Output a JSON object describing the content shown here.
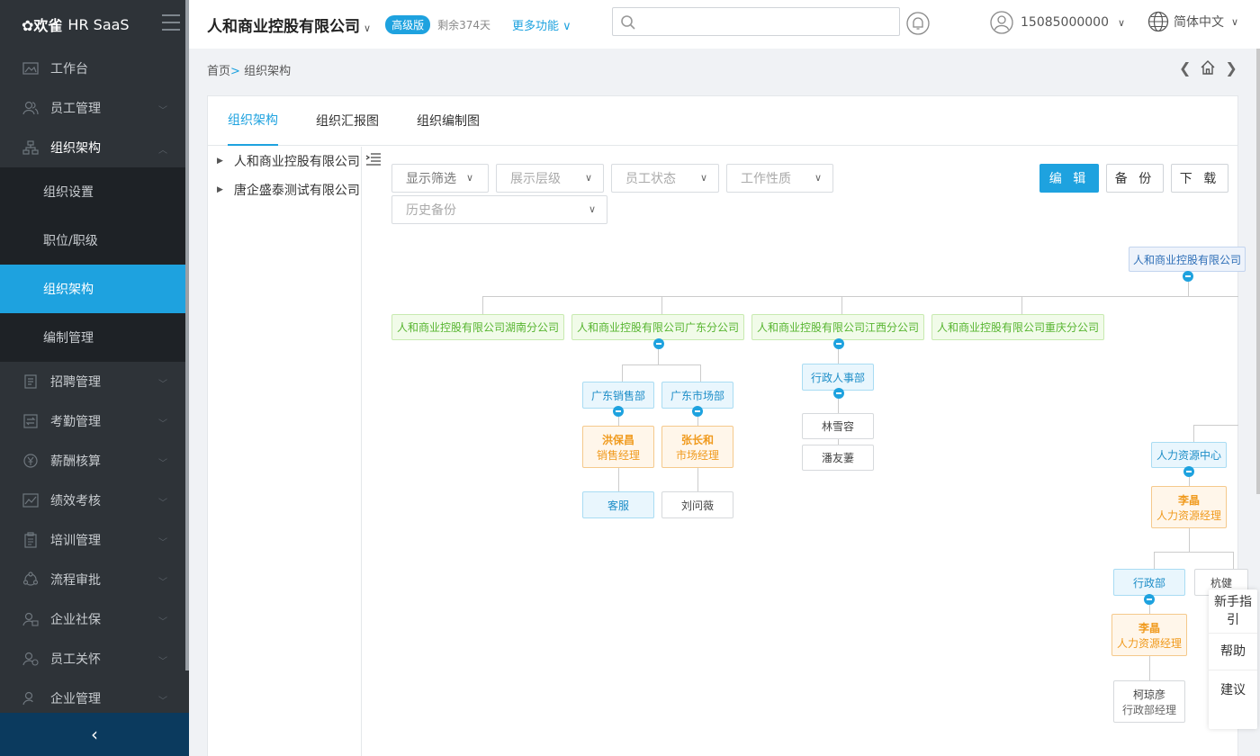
{
  "brand": {
    "mark": "✿欢雀",
    "name": "HR SaaS"
  },
  "header": {
    "company": "人和商业控股有限公司",
    "badge": "高级版",
    "remain": "剩余374天",
    "more": "更多功能",
    "search_placeholder": "",
    "user": "15085000000",
    "lang": "简体中文"
  },
  "menu": {
    "workbench": "工作台",
    "employee": "员工管理",
    "org": "组织架构",
    "org_sub": [
      "组织设置",
      "职位/职级",
      "组织架构",
      "编制管理"
    ],
    "recruit": "招聘管理",
    "attendance": "考勤管理",
    "salary": "薪酬核算",
    "performance": "绩效考核",
    "training": "培训管理",
    "workflow": "流程审批",
    "social": "企业社保",
    "relation": "员工关怀",
    "enterprise": "企业管理"
  },
  "breadcrumb": {
    "home": "首页",
    "sep": ">",
    "current": "组织架构"
  },
  "tabs": [
    "组织架构",
    "组织汇报图",
    "组织编制图"
  ],
  "tree": [
    "人和商业控股有限公司",
    "唐企盛泰测试有限公司"
  ],
  "filters": {
    "display": "显示筛选",
    "level": "展示层级",
    "status": "员工状态",
    "nature": "工作性质",
    "history": "历史备份"
  },
  "buttons": {
    "edit": "编 辑",
    "backup": "备 份",
    "download": "下 载"
  },
  "chart_nodes": {
    "root": "人和商业控股有限公司",
    "branch_hunan": "人和商业控股有限公司湖南分公司",
    "branch_guangdong": "人和商业控股有限公司广东分公司",
    "branch_jiangxi": "人和商业控股有限公司江西分公司",
    "branch_chongqing": "人和商业控股有限公司重庆分公司",
    "gd_sales": "广东销售部",
    "gd_market": "广东市场部",
    "hong_name": "洪保昌",
    "hong_title": "销售经理",
    "zhang_name": "张长和",
    "zhang_title": "市场经理",
    "kefu": "客服",
    "liu": "刘问薇",
    "jx_admin": "行政人事部",
    "lin": "林雪容",
    "pan": "潘友萋",
    "hr_center": "人力资源中心",
    "li_name": "李晶",
    "li_title": "人力资源经理",
    "admin_dept": "行政部",
    "hang": "杭健",
    "li2_name": "李晶",
    "li2_title": "人力资源经理",
    "ke_name": "柯琼彦",
    "ke_title": "行政部经理"
  },
  "help": {
    "guide": "新手指引",
    "help": "帮助",
    "suggest": "建议"
  }
}
